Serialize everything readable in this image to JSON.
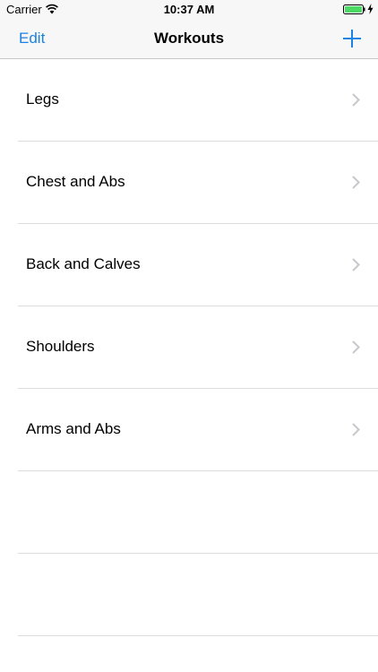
{
  "status_bar": {
    "carrier": "Carrier",
    "time": "10:37 AM",
    "battery_color": "#4cd964"
  },
  "nav_bar": {
    "edit_label": "Edit",
    "title": "Workouts",
    "add_icon": "plus-icon",
    "accent_color": "#1a82e2"
  },
  "workouts": [
    {
      "label": "Legs"
    },
    {
      "label": "Chest and Abs"
    },
    {
      "label": "Back and Calves"
    },
    {
      "label": "Shoulders"
    },
    {
      "label": "Arms and Abs"
    }
  ]
}
